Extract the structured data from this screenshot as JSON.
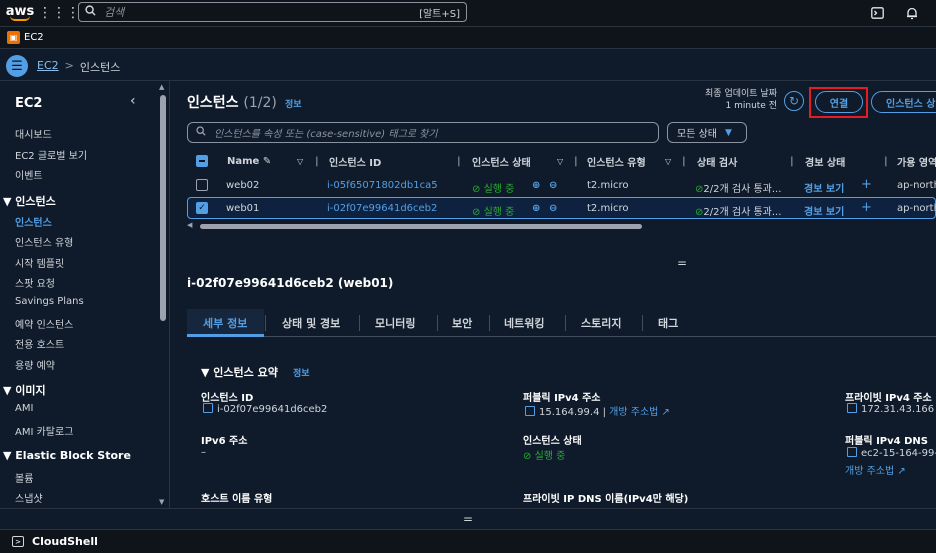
{
  "topnav": {
    "logo": "aws",
    "search_placeholder": "검색",
    "search_shortcut": "[알트+S]"
  },
  "service": {
    "name": "EC2"
  },
  "breadcrumb": {
    "root": "EC2",
    "sep": ">",
    "current": "인스턴스"
  },
  "sidebar": {
    "title": "EC2",
    "collapse_icon": "‹",
    "top_items": [
      "대시보드",
      "EC2 글로벌 보기",
      "이벤트"
    ],
    "sections": [
      {
        "title": "▼ 인스턴스",
        "items": [
          "인스턴스",
          "인스턴스 유형",
          "시작 템플릿",
          "스팟 요청",
          "Savings Plans",
          "예약 인스턴스",
          "전용 호스트",
          "용량 예약"
        ]
      },
      {
        "title": "▼ 이미지",
        "items": [
          "AMI",
          "AMI 카탈로그"
        ]
      },
      {
        "title": "▼ Elastic Block Store",
        "items": [
          "볼륨",
          "스냅샷"
        ]
      }
    ]
  },
  "instances": {
    "title": "인스턴스",
    "count": "(1/2)",
    "info": "정보",
    "last_updated_label": "최종 업데이트 날짜",
    "last_updated_value": "1 minute 전",
    "connect_label": "연결",
    "state_button_label": "인스턴스 상태",
    "filter_placeholder": "인스턴스를 속성 또는 (case-sensitive) 태그로 찾기",
    "state_filter": "모든 상태",
    "columns": [
      "Name",
      "인스턴스 ID",
      "인스턴스 상태",
      "인스턴스 유형",
      "상태 검사",
      "경보 상태",
      "가용 영역"
    ],
    "rows": [
      {
        "name": "web02",
        "id": "i-05f65071802db1ca5",
        "state": "실행 중",
        "type": "t2.micro",
        "check": "2/2개 검사 통과...",
        "alarm": "경보 보기",
        "az": "ap-north",
        "selected": false
      },
      {
        "name": "web01",
        "id": "i-02f07e99641d6ceb2",
        "state": "실행 중",
        "type": "t2.micro",
        "check": "2/2개 검사 통과...",
        "alarm": "경보 보기",
        "az": "ap-north",
        "selected": true
      }
    ]
  },
  "detail": {
    "heading": "i-02f07e99641d6ceb2 (web01)",
    "tabs": [
      "세부 정보",
      "상태 및 경보",
      "모니터링",
      "보안",
      "네트워킹",
      "스토리지",
      "태그"
    ],
    "summary_title": "▼ 인스턴스 요약",
    "summary_info": "정보",
    "fields": {
      "instance_id_label": "인스턴스 ID",
      "instance_id_value": "i-02f07e99641d6ceb2",
      "ipv6_label": "IPv6 주소",
      "ipv6_value": "–",
      "hostname_type_label": "호스트 이름 유형",
      "public_ipv4_label": "퍼블릭 IPv4 주소",
      "public_ipv4_value": "15.164.99.4",
      "open_address": "개방 주소법",
      "instance_state_label": "인스턴스 상태",
      "instance_state_value": "실행 중",
      "private_dns_label": "프라이빗 IP DNS 이름(IPv4만 해당)",
      "private_ipv4_label": "프라이빗 IPv4 주소",
      "private_ipv4_value": "172.31.43.166",
      "public_dns_label": "퍼블릭 IPv4 DNS",
      "public_dns_value": "ec2-15-164-99-",
      "open_address_2": "개방 주소법"
    }
  },
  "cloudshell": {
    "label": "CloudShell"
  },
  "colors": {
    "accent": "#539fe5",
    "running": "#29ad32",
    "highlight": "#e51c23"
  }
}
